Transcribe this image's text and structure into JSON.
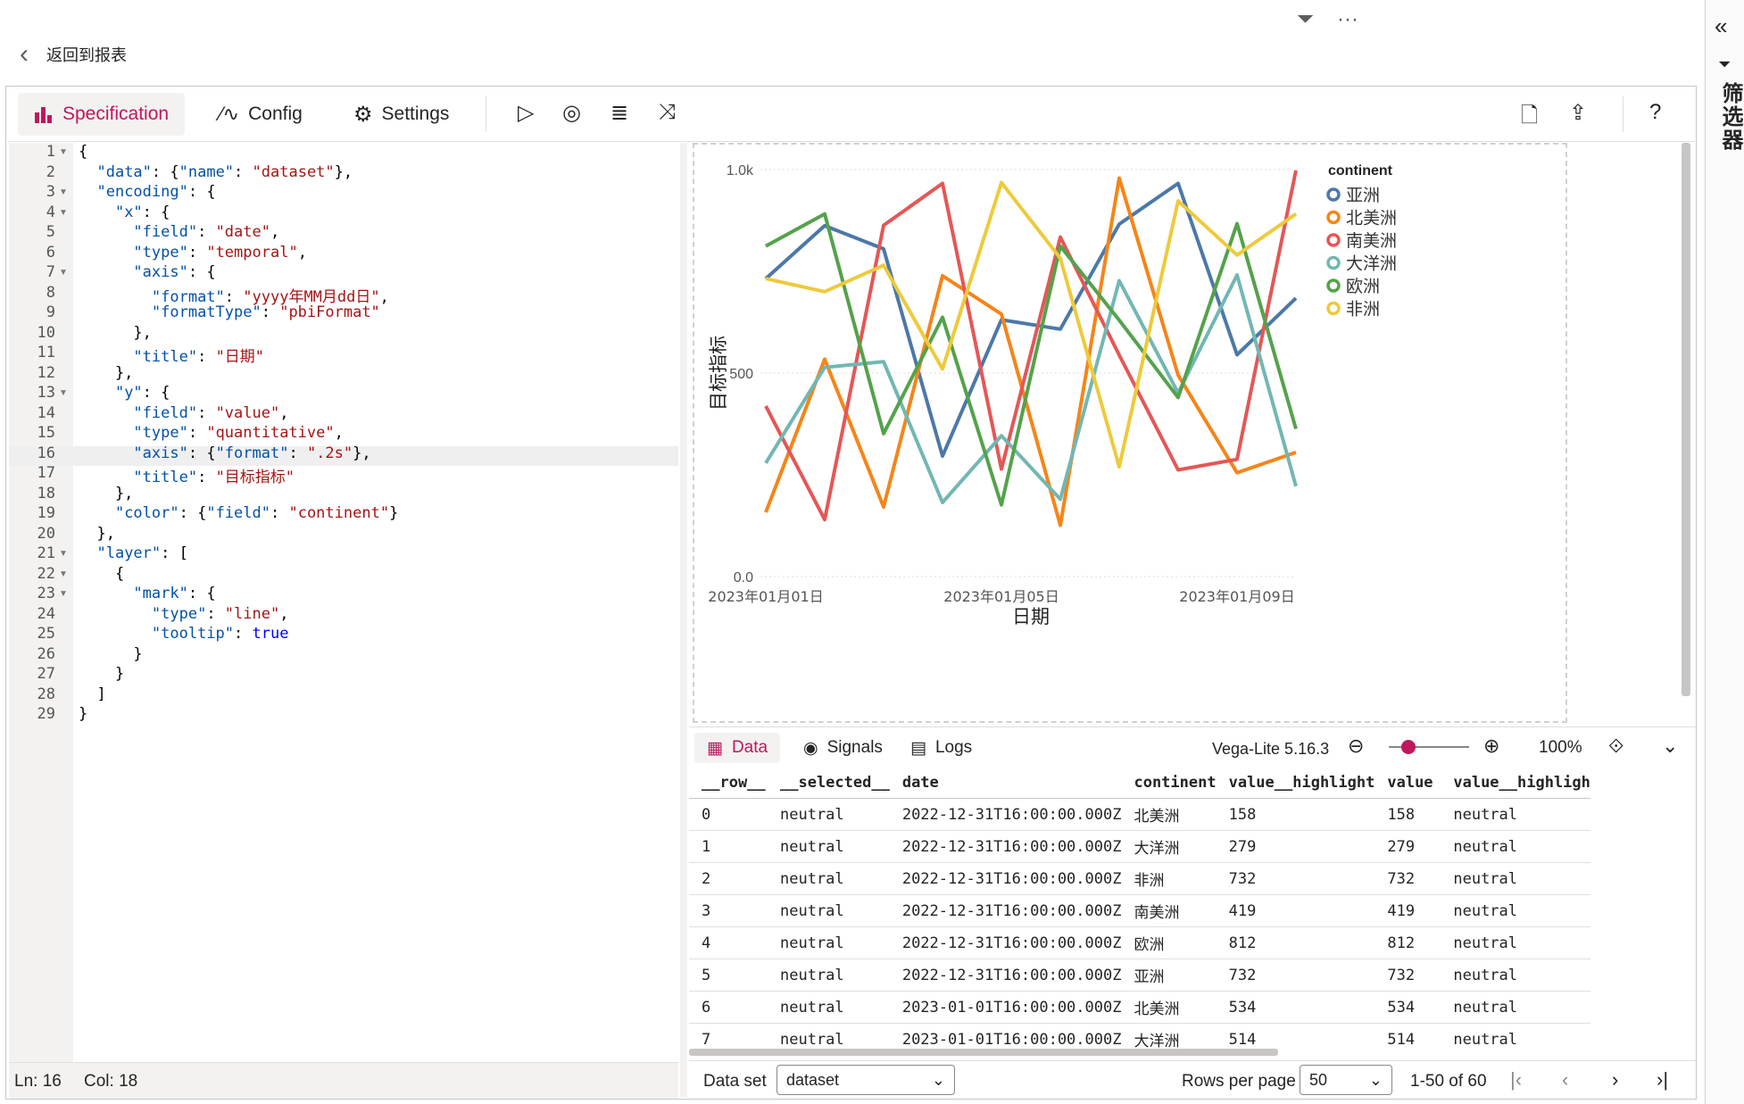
{
  "topbar": {
    "filter_icon": "funnel-icon",
    "more_icon": "more-icon"
  },
  "filters_pane": {
    "label": "筛选器",
    "collapse_icon": "double-chevron-left-icon",
    "filter_icon": "funnel-icon"
  },
  "back": {
    "label": "返回到报表"
  },
  "toolbar": {
    "specification": "Specification",
    "config": "Config",
    "settings": "Settings",
    "icons": [
      "run-icon",
      "auto-run-icon",
      "format-icon",
      "repair-icon",
      "file-icon",
      "share-icon",
      "help-icon"
    ],
    "help": "?"
  },
  "editor": {
    "lines": [
      {
        "n": "1",
        "fold": true
      },
      {
        "n": "2"
      },
      {
        "n": "3",
        "fold": true
      },
      {
        "n": "4",
        "fold": true
      },
      {
        "n": "5"
      },
      {
        "n": "6"
      },
      {
        "n": "7",
        "fold": true
      },
      {
        "n": "8"
      },
      {
        "n": "9"
      },
      {
        "n": "10"
      },
      {
        "n": "11"
      },
      {
        "n": "12"
      },
      {
        "n": "13",
        "fold": true
      },
      {
        "n": "14"
      },
      {
        "n": "15"
      },
      {
        "n": "16"
      },
      {
        "n": "17"
      },
      {
        "n": "18"
      },
      {
        "n": "19"
      },
      {
        "n": "20"
      },
      {
        "n": "21",
        "fold": true
      },
      {
        "n": "22",
        "fold": true
      },
      {
        "n": "23",
        "fold": true
      },
      {
        "n": "24"
      },
      {
        "n": "25"
      },
      {
        "n": "26"
      },
      {
        "n": "27"
      },
      {
        "n": "28"
      },
      {
        "n": "29"
      }
    ],
    "code": [
      "{",
      "  \"data\": {\"name\": \"dataset\"},",
      "  \"encoding\": {",
      "    \"x\": {",
      "      \"field\": \"date\",",
      "      \"type\": \"temporal\",",
      "      \"axis\": {",
      "        \"format\": \"yyyy年MM月dd日\",",
      "        \"formatType\": \"pbiFormat\"",
      "      },",
      "      \"title\": \"日期\"",
      "    },",
      "    \"y\": {",
      "      \"field\": \"value\",",
      "      \"type\": \"quantitative\",",
      "      \"axis\": {\"format\": \".2s\"},",
      "      \"title\": \"目标指标\"",
      "    },",
      "    \"color\": {\"field\": \"continent\"}",
      "  },",
      "  \"layer\": [",
      "    {",
      "      \"mark\": {",
      "        \"type\": \"line\",",
      "        \"tooltip\": true",
      "      }",
      "    }",
      "  ]",
      "}"
    ],
    "current_line": 16,
    "status_ln": "Ln: 16",
    "status_col": "Col: 18"
  },
  "chart_data": {
    "type": "line",
    "x": [
      "2023-01-01",
      "2023-01-02",
      "2023-01-03",
      "2023-01-04",
      "2023-01-05",
      "2023-01-06",
      "2023-01-07",
      "2023-01-08",
      "2023-01-09",
      "2023-01-10"
    ],
    "x_tick_labels": [
      "2023年01月01日",
      "2023年01月05日",
      "2023年01月09日"
    ],
    "x_tick_dates": [
      "2023-01-01",
      "2023-01-05",
      "2023-01-09"
    ],
    "y_ticks": [
      "0.0",
      "500",
      "1.0k"
    ],
    "y_tick_values": [
      0,
      500,
      1000
    ],
    "ylim": [
      0,
      1000
    ],
    "xlabel": "日期",
    "ylabel": "目标指标",
    "legend_title": "continent",
    "legend_position": "top-right",
    "grid": true,
    "series": [
      {
        "name": "亚洲",
        "color": "#4c78a8",
        "values": [
          732,
          862,
          805,
          296,
          631,
          608,
          866,
          966,
          545,
          684
        ]
      },
      {
        "name": "北美洲",
        "color": "#f58518",
        "values": [
          158,
          534,
          171,
          739,
          645,
          126,
          979,
          495,
          255,
          305
        ]
      },
      {
        "name": "南美洲",
        "color": "#e45756",
        "values": [
          419,
          140,
          863,
          966,
          264,
          834,
          544,
          262,
          288,
          998
        ]
      },
      {
        "name": "大洋洲",
        "color": "#72b7b2",
        "values": [
          279,
          514,
          528,
          182,
          346,
          190,
          727,
          451,
          741,
          222
        ]
      },
      {
        "name": "欧洲",
        "color": "#54a24b",
        "values": [
          812,
          891,
          351,
          637,
          176,
          812,
          630,
          440,
          867,
          363
        ]
      },
      {
        "name": "非洲",
        "color": "#eeca3b",
        "values": [
          732,
          700,
          765,
          510,
          968,
          782,
          270,
          923,
          790,
          891
        ]
      }
    ]
  },
  "data_tabs": {
    "data": "Data",
    "signals": "Signals",
    "logs": "Logs",
    "version": "Vega-Lite 5.16.3",
    "zoom": "100%",
    "zoom_level": 0.2
  },
  "table": {
    "columns": [
      "__row__",
      "__selected__",
      "date",
      "continent",
      "value__highlight",
      "value",
      "value__highligh"
    ],
    "rows": [
      [
        "0",
        "neutral",
        "2022-12-31T16:00:00.000Z",
        "北美洲",
        "158",
        "158",
        "neutral"
      ],
      [
        "1",
        "neutral",
        "2022-12-31T16:00:00.000Z",
        "大洋洲",
        "279",
        "279",
        "neutral"
      ],
      [
        "2",
        "neutral",
        "2022-12-31T16:00:00.000Z",
        "非洲",
        "732",
        "732",
        "neutral"
      ],
      [
        "3",
        "neutral",
        "2022-12-31T16:00:00.000Z",
        "南美洲",
        "419",
        "419",
        "neutral"
      ],
      [
        "4",
        "neutral",
        "2022-12-31T16:00:00.000Z",
        "欧洲",
        "812",
        "812",
        "neutral"
      ],
      [
        "5",
        "neutral",
        "2022-12-31T16:00:00.000Z",
        "亚洲",
        "732",
        "732",
        "neutral"
      ],
      [
        "6",
        "neutral",
        "2023-01-01T16:00:00.000Z",
        "北美洲",
        "534",
        "534",
        "neutral"
      ],
      [
        "7",
        "neutral",
        "2023-01-01T16:00:00.000Z",
        "大洋洲",
        "514",
        "514",
        "neutral"
      ]
    ]
  },
  "footer": {
    "dataset_label": "Data set",
    "dataset_value": "dataset",
    "rows_per_page_label": "Rows per page",
    "rows_per_page_value": "50",
    "range": "1-50 of 60"
  }
}
